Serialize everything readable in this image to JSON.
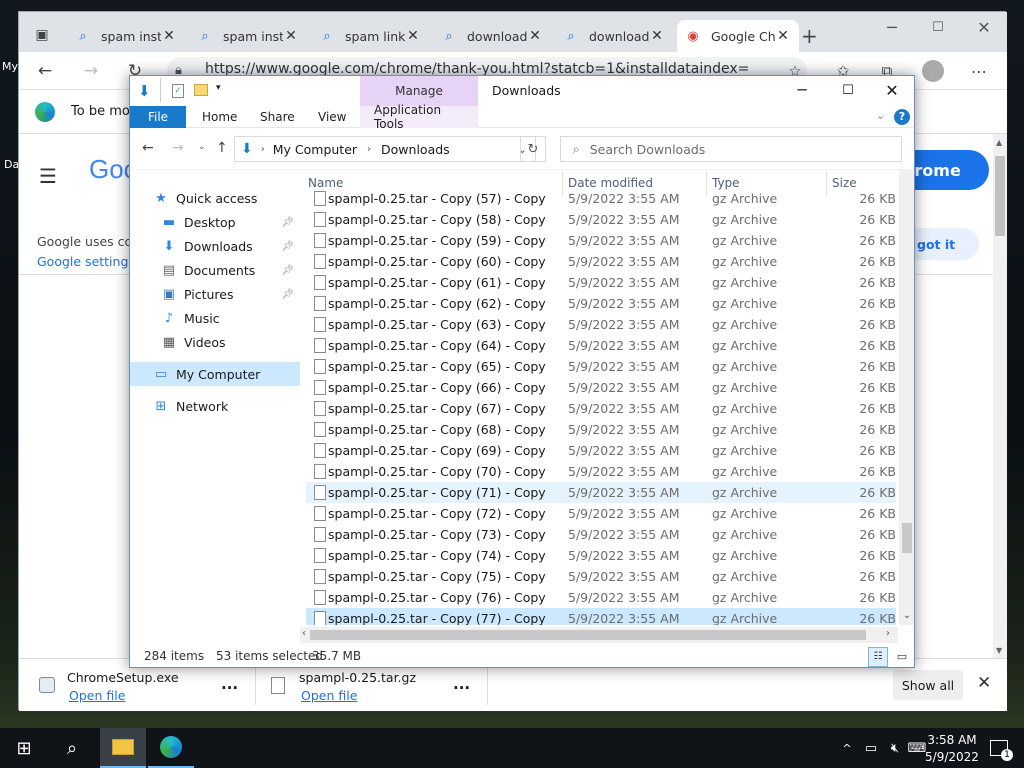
{
  "desktop": {
    "left_labels": [
      "My",
      "Da"
    ]
  },
  "browser": {
    "tabs": [
      {
        "title": "spam insta",
        "icon": "search-icon"
      },
      {
        "title": "spam insta",
        "icon": "search-icon"
      },
      {
        "title": "spam link",
        "icon": "search-icon"
      },
      {
        "title": "download",
        "icon": "search-icon"
      },
      {
        "title": "download",
        "icon": "search-icon"
      },
      {
        "title": "Google Ch",
        "icon": "chrome-icon",
        "active": true
      }
    ],
    "new_tab": "+",
    "url": "https://www.google.com/chrome/thank-you.html?statcb=1&installdataindex=",
    "infobar_text": "To be mos",
    "page": {
      "logo_text": "Goo",
      "cookie_text": "Google uses coo",
      "settings_link": "Google settings c",
      "chrome_button": "hrome",
      "got_it": "got it"
    },
    "downloads": [
      {
        "file": "ChromeSetup.exe",
        "action": "Open file"
      },
      {
        "file": "spampl-0.25.tar.gz",
        "action": "Open file"
      }
    ],
    "more": "...",
    "show_all": "Show all"
  },
  "explorer": {
    "title": "Downloads",
    "manage": "Manage",
    "ribbon_tabs": [
      "File",
      "Home",
      "Share",
      "View",
      "Application Tools"
    ],
    "breadcrumb": [
      "My Computer",
      "Downloads"
    ],
    "search_placeholder": "Search Downloads",
    "nav": [
      {
        "label": "Quick access",
        "icon": "star-icon",
        "pinned": false,
        "indent": 0
      },
      {
        "label": "Desktop",
        "icon": "desktop-icon",
        "pinned": true,
        "indent": 1
      },
      {
        "label": "Downloads",
        "icon": "download-arrow-icon",
        "pinned": true,
        "indent": 1
      },
      {
        "label": "Documents",
        "icon": "documents-icon",
        "pinned": true,
        "indent": 1
      },
      {
        "label": "Pictures",
        "icon": "pictures-icon",
        "pinned": true,
        "indent": 1
      },
      {
        "label": "Music",
        "icon": "music-icon",
        "pinned": false,
        "indent": 1
      },
      {
        "label": "Videos",
        "icon": "videos-icon",
        "pinned": false,
        "indent": 1
      },
      {
        "label": "My Computer",
        "icon": "computer-icon",
        "pinned": false,
        "indent": 0,
        "selected": true
      },
      {
        "label": "Network",
        "icon": "network-icon",
        "pinned": false,
        "indent": 0
      }
    ],
    "columns": [
      "Name",
      "Date modified",
      "Type",
      "Size"
    ],
    "rows": [
      {
        "name": "spampl-0.25.tar - Copy (57) - Copy",
        "date": "5/9/2022 3:55 AM",
        "type": "gz Archive",
        "size": "26 KB"
      },
      {
        "name": "spampl-0.25.tar - Copy (58) - Copy",
        "date": "5/9/2022 3:55 AM",
        "type": "gz Archive",
        "size": "26 KB"
      },
      {
        "name": "spampl-0.25.tar - Copy (59) - Copy",
        "date": "5/9/2022 3:55 AM",
        "type": "gz Archive",
        "size": "26 KB"
      },
      {
        "name": "spampl-0.25.tar - Copy (60) - Copy",
        "date": "5/9/2022 3:55 AM",
        "type": "gz Archive",
        "size": "26 KB"
      },
      {
        "name": "spampl-0.25.tar - Copy (61) - Copy",
        "date": "5/9/2022 3:55 AM",
        "type": "gz Archive",
        "size": "26 KB"
      },
      {
        "name": "spampl-0.25.tar - Copy (62) - Copy",
        "date": "5/9/2022 3:55 AM",
        "type": "gz Archive",
        "size": "26 KB"
      },
      {
        "name": "spampl-0.25.tar - Copy (63) - Copy",
        "date": "5/9/2022 3:55 AM",
        "type": "gz Archive",
        "size": "26 KB"
      },
      {
        "name": "spampl-0.25.tar - Copy (64) - Copy",
        "date": "5/9/2022 3:55 AM",
        "type": "gz Archive",
        "size": "26 KB"
      },
      {
        "name": "spampl-0.25.tar - Copy (65) - Copy",
        "date": "5/9/2022 3:55 AM",
        "type": "gz Archive",
        "size": "26 KB"
      },
      {
        "name": "spampl-0.25.tar - Copy (66) - Copy",
        "date": "5/9/2022 3:55 AM",
        "type": "gz Archive",
        "size": "26 KB"
      },
      {
        "name": "spampl-0.25.tar - Copy (67) - Copy",
        "date": "5/9/2022 3:55 AM",
        "type": "gz Archive",
        "size": "26 KB"
      },
      {
        "name": "spampl-0.25.tar - Copy (68) - Copy",
        "date": "5/9/2022 3:55 AM",
        "type": "gz Archive",
        "size": "26 KB"
      },
      {
        "name": "spampl-0.25.tar - Copy (69) - Copy",
        "date": "5/9/2022 3:55 AM",
        "type": "gz Archive",
        "size": "26 KB"
      },
      {
        "name": "spampl-0.25.tar - Copy (70) - Copy",
        "date": "5/9/2022 3:55 AM",
        "type": "gz Archive",
        "size": "26 KB"
      },
      {
        "name": "spampl-0.25.tar - Copy (71) - Copy",
        "date": "5/9/2022 3:55 AM",
        "type": "gz Archive",
        "size": "26 KB",
        "state": "hover"
      },
      {
        "name": "spampl-0.25.tar - Copy (72) - Copy",
        "date": "5/9/2022 3:55 AM",
        "type": "gz Archive",
        "size": "26 KB"
      },
      {
        "name": "spampl-0.25.tar - Copy (73) - Copy",
        "date": "5/9/2022 3:55 AM",
        "type": "gz Archive",
        "size": "26 KB"
      },
      {
        "name": "spampl-0.25.tar - Copy (74) - Copy",
        "date": "5/9/2022 3:55 AM",
        "type": "gz Archive",
        "size": "26 KB"
      },
      {
        "name": "spampl-0.25.tar - Copy (75) - Copy",
        "date": "5/9/2022 3:55 AM",
        "type": "gz Archive",
        "size": "26 KB"
      },
      {
        "name": "spampl-0.25.tar - Copy (76) - Copy",
        "date": "5/9/2022 3:55 AM",
        "type": "gz Archive",
        "size": "26 KB"
      },
      {
        "name": "spampl-0.25.tar - Copy (77) - Copy",
        "date": "5/9/2022 3:55 AM",
        "type": "gz Archive",
        "size": "26 KB",
        "state": "selected"
      }
    ],
    "status": {
      "items": "284 items",
      "selected": "53 items selected",
      "size": "35.7 MB"
    }
  },
  "taskbar": {
    "time": "3:58 AM",
    "date": "5/9/2022",
    "notifications": "1"
  },
  "colors": {
    "explorer_blue": "#1979ca",
    "manage_tab": "#e6d3f5",
    "selected_row": "#cce8ff"
  }
}
